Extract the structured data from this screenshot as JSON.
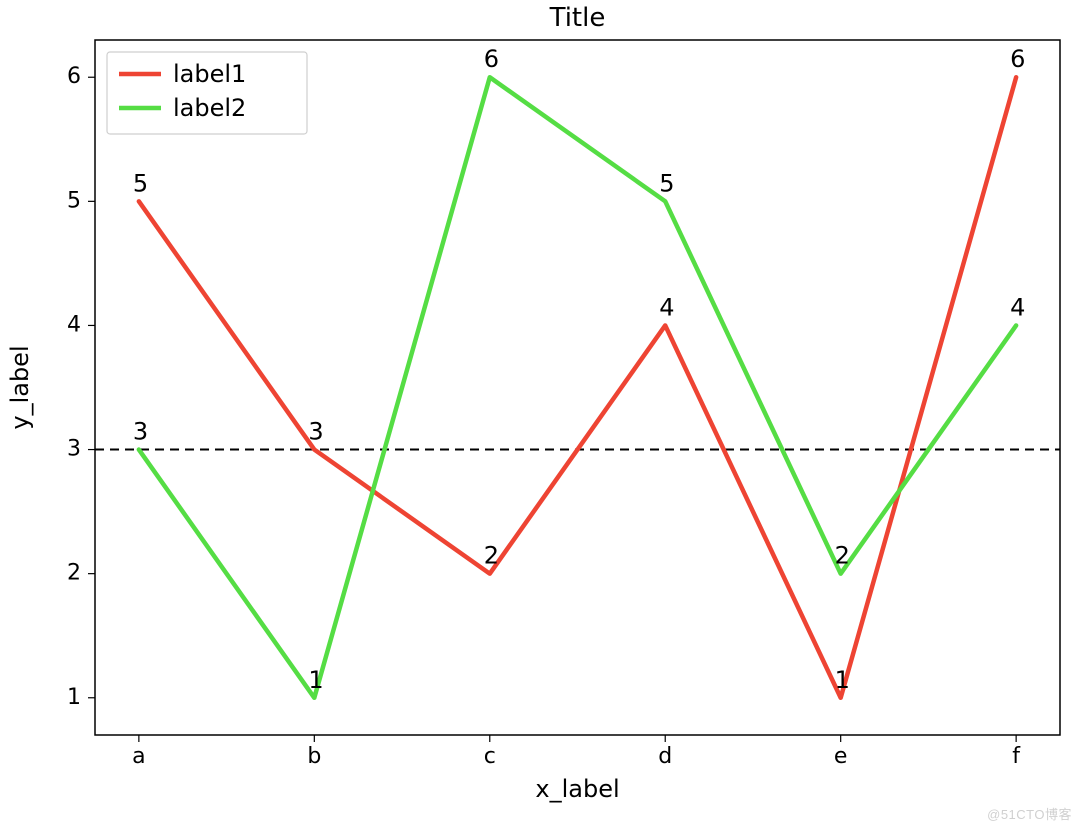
{
  "chart_data": {
    "type": "line",
    "title": "Title",
    "xlabel": "x_label",
    "ylabel": "y_label",
    "categories": [
      "a",
      "b",
      "c",
      "d",
      "e",
      "f"
    ],
    "y_ticks": [
      1,
      2,
      3,
      4,
      5,
      6
    ],
    "ylim": [
      0.7,
      6.3
    ],
    "series": [
      {
        "name": "label1",
        "color": "#ee4433",
        "values": [
          5,
          3,
          2,
          4,
          1,
          6
        ]
      },
      {
        "name": "label2",
        "color": "#55dd44",
        "values": [
          3,
          1,
          6,
          5,
          2,
          4
        ]
      }
    ],
    "hline": {
      "y": 3,
      "style": "dashed",
      "color": "#000000"
    },
    "legend_position": "upper-left",
    "watermark": "@51CTO博客"
  }
}
